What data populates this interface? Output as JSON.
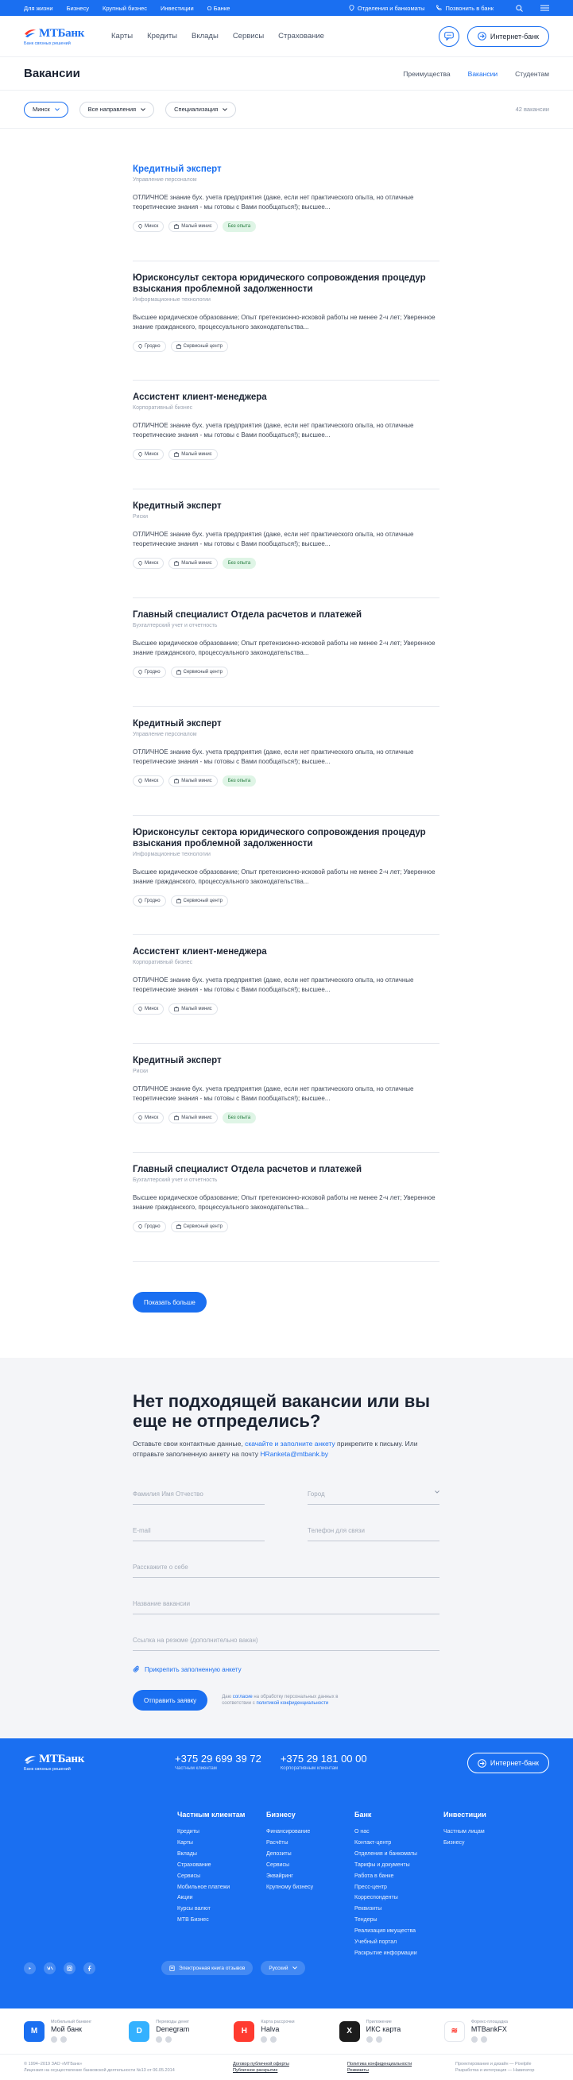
{
  "topbar": {
    "links": [
      "Для жизни",
      "Бизнесу",
      "Крупный бизнес",
      "Инвестиции",
      "О Банке"
    ],
    "branches": "Отделения и банкоматы",
    "call": "Позвонить в банк"
  },
  "header": {
    "logo_name": "МТБанк",
    "logo_sub": "Банк связных решений",
    "nav": [
      "Карты",
      "Кредиты",
      "Вклады",
      "Сервисы",
      "Страхование"
    ],
    "internet_bank": "Интернет-банк"
  },
  "page": {
    "title": "Вакансии",
    "tabs": [
      "Преимущества",
      "Вакансии",
      "Студентам"
    ],
    "active_tab": "Вакансии"
  },
  "filters": {
    "city": "Минск",
    "direction": "Все направления",
    "specialization": "Специализация",
    "count": "42 вакансии"
  },
  "vacancies": [
    {
      "title": "Кредитный эксперт",
      "dept": "Управление персоналом",
      "desc": "ОТЛИЧНОЕ знание бух. учета предприятия (даже, если нет практического опыта, но отличные теоретические знания - мы готовы с Вами пообщаться!); высшее...",
      "location": "Минск",
      "office": "Малый миниc",
      "badge": "Без опыта"
    },
    {
      "title": "Юрисконсульт сектора юридического сопровождения процедур взыскания проблемной задолженности",
      "dept": "Информационные технологии",
      "desc": "Высшее юридическое образование; Опыт претензионно-исковой работы не менее 2-ч лет; Уверенное знание гражданского, процессуального законодательства...",
      "location": "Гродно",
      "office": "Сервисный центр",
      "badge": ""
    },
    {
      "title": "Ассистент клиент-менеджера",
      "dept": "Корпоративный бизнес",
      "desc": "ОТЛИЧНОЕ знание бух. учета предприятия (даже, если нет практического опыта, но отличные теоретические знания - мы готовы с Вами пообщаться!); высшее...",
      "location": "Минск",
      "office": "Малый миниc",
      "badge": ""
    },
    {
      "title": "Кредитный эксперт",
      "dept": "Риски",
      "desc": "ОТЛИЧНОЕ знание бух. учета предприятия (даже, если нет практического опыта, но отличные теоретические знания - мы готовы с Вами пообщаться!); высшее...",
      "location": "Минск",
      "office": "Малый миниc",
      "badge": "Без опыта"
    },
    {
      "title": "Главный специалист Отдела расчетов и платежей",
      "dept": "Бухгалтерский учет и отчетность",
      "desc": "Высшее юридическое образование; Опыт претензионно-исковой работы не менее 2-ч лет; Уверенное знание гражданского, процессуального законодательства...",
      "location": "Гродно",
      "office": "Сервисный центр",
      "badge": ""
    },
    {
      "title": "Кредитный эксперт",
      "dept": "Управление персоналом",
      "desc": "ОТЛИЧНОЕ знание бух. учета предприятия (даже, если нет практического опыта, но отличные теоретические знания - мы готовы с Вами пообщаться!); высшее...",
      "location": "Минск",
      "office": "Малый миниc",
      "badge": "Без опыта"
    },
    {
      "title": "Юрисконсульт сектора юридического сопровождения процедур взыскания проблемной задолженности",
      "dept": "Информационные технологии",
      "desc": "Высшее юридическое образование; Опыт претензионно-исковой работы не менее 2-ч лет; Уверенное знание гражданского, процессуального законодательства...",
      "location": "Гродно",
      "office": "Сервисный центр",
      "badge": ""
    },
    {
      "title": "Ассистент клиент-менеджера",
      "dept": "Корпоративный бизнес",
      "desc": "ОТЛИЧНОЕ знание бух. учета предприятия (даже, если нет практического опыта, но отличные теоретические знания - мы готовы с Вами пообщаться!); высшее...",
      "location": "Минск",
      "office": "Малый миниc",
      "badge": ""
    },
    {
      "title": "Кредитный эксперт",
      "dept": "Риски",
      "desc": "ОТЛИЧНОЕ знание бух. учета предприятия (даже, если нет практического опыта, но отличные теоретические знания - мы готовы с Вами пообщаться!); высшее...",
      "location": "Минск",
      "office": "Малый миниc",
      "badge": "Без опыта"
    },
    {
      "title": "Главный специалист Отдела расчетов и платежей",
      "dept": "Бухгалтерский учет и отчетность",
      "desc": "Высшее юридическое образование; Опыт претензионно-исковой работы не менее 2-ч лет; Уверенное знание гражданского, процессуального законодательства...",
      "location": "Гродно",
      "office": "Сервисный центр",
      "badge": ""
    }
  ],
  "show_more": "Показать больше",
  "form": {
    "title": "Нет подходящей вакансии или вы еще не отпределись?",
    "intro_1": "Оставьте свои контактные данные, ",
    "intro_link": "скачайте и заполните анкету",
    "intro_2": " прикрепите к письму. Или отправьте заполненную анкету на почту ",
    "email": "HRanketa@mtbank.by",
    "name": "Фамилия Имя Отчество",
    "city": "Город",
    "email_ph": "E-mail",
    "phone_ph": "Телефон для связи",
    "about": "Расскажите о себе",
    "vacancy": "Название вакансии",
    "link": "Ссылка на резюме (дополнительно вакан)",
    "attach": "Прикрепить заполненную анкету",
    "submit": "Отправить заявку",
    "consent_1": "Даю ",
    "consent_link1": "согласие",
    "consent_2": " на обработку персональных данных ",
    "consent_3": "в соответствии с ",
    "consent_link2": "политикой конфиденциальности"
  },
  "footer": {
    "phone1": "+375 29 699 39 72",
    "phone1_label": "Частным клиентам",
    "phone2": "+375 29 181 00 00",
    "phone2_label": "Корпоративным клиентам",
    "internet_bank": "Интернет-банк",
    "columns": [
      {
        "title": "Частным клиентам",
        "items": [
          "Кредиты",
          "Карты",
          "Вклады",
          "Страхование",
          "Сервисы",
          "Мобильное платежи",
          "Акции",
          "Курсы валют",
          "MTB Бизнес"
        ]
      },
      {
        "title": "Бизнесу",
        "items": [
          "Финансирование",
          "Расчёты",
          "Депозиты",
          "Сервисы",
          "Эквайринг",
          "Крупному бизнесу"
        ]
      },
      {
        "title": "Банк",
        "items": [
          "О нас",
          "Контакт-центр",
          "Отделения и банкоматы",
          "Тарифы и документы",
          "Работа в банке",
          "Пресс-центр",
          "Корреспонденты",
          "Реквизиты",
          "Тендеры",
          "Реализация имущества",
          "Учебный портал",
          "Раскрытие информации"
        ]
      },
      {
        "title": "Инвестиции",
        "items": [
          "Частным лицам",
          "Бизнесу"
        ]
      }
    ],
    "feedback": "Электронная книга отзывов",
    "lang": "Русский"
  },
  "apps": [
    {
      "label": "Мобильный банкинг",
      "name": "Мой банк",
      "color": "#1a6ff1",
      "icon": "М"
    },
    {
      "label": "Переводы денег",
      "name": "Denegram",
      "color": "#34b1ff",
      "icon": "D"
    },
    {
      "label": "Карта рассрочки",
      "name": "Halva",
      "color": "#ff3b30",
      "icon": "H"
    },
    {
      "label": "Приложение",
      "name": "ИКС карта",
      "color": "#1c1c1c",
      "icon": "X"
    },
    {
      "label": "Форекс-площадка",
      "name": "MTBankFX",
      "color": "#ffffff",
      "icon": "≋"
    }
  ],
  "legal": {
    "c1a": "© 1994–2019 ЗАО «МТБанк»",
    "c1b": "Лицензия на осуществление банковской деятельности №13 от 06.05.2014",
    "c2a": "Договор публичной оферты",
    "c2b": "Публичное раскрытие",
    "c3a": "Политика конфиденциальности",
    "c3b": "Реквизиты",
    "c4a": "Проектирование и дизайн — Pixelpile",
    "c4b": "Разработка и интеграция — Навигатор"
  }
}
